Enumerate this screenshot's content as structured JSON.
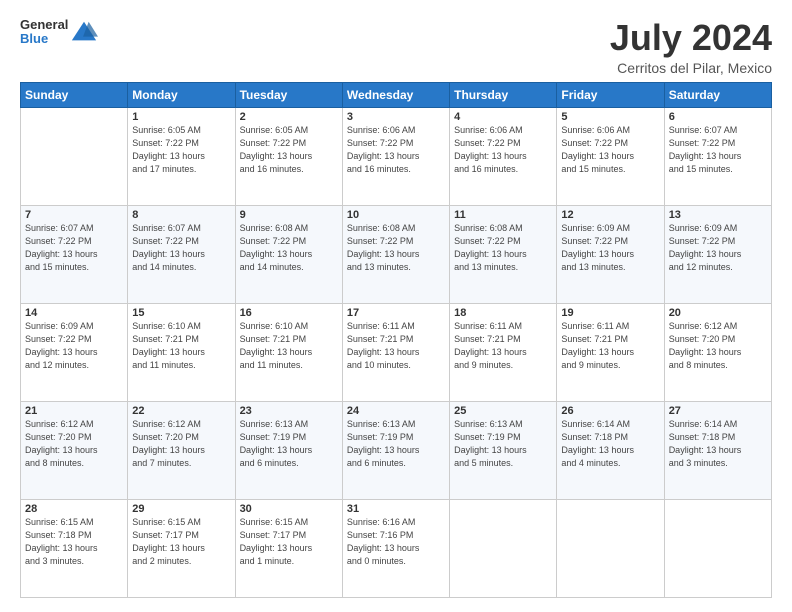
{
  "logo": {
    "line1": "General",
    "line2": "Blue"
  },
  "title": "July 2024",
  "subtitle": "Cerritos del Pilar, Mexico",
  "days_header": [
    "Sunday",
    "Monday",
    "Tuesday",
    "Wednesday",
    "Thursday",
    "Friday",
    "Saturday"
  ],
  "weeks": [
    [
      {
        "num": "",
        "info": ""
      },
      {
        "num": "1",
        "info": "Sunrise: 6:05 AM\nSunset: 7:22 PM\nDaylight: 13 hours\nand 17 minutes."
      },
      {
        "num": "2",
        "info": "Sunrise: 6:05 AM\nSunset: 7:22 PM\nDaylight: 13 hours\nand 16 minutes."
      },
      {
        "num": "3",
        "info": "Sunrise: 6:06 AM\nSunset: 7:22 PM\nDaylight: 13 hours\nand 16 minutes."
      },
      {
        "num": "4",
        "info": "Sunrise: 6:06 AM\nSunset: 7:22 PM\nDaylight: 13 hours\nand 16 minutes."
      },
      {
        "num": "5",
        "info": "Sunrise: 6:06 AM\nSunset: 7:22 PM\nDaylight: 13 hours\nand 15 minutes."
      },
      {
        "num": "6",
        "info": "Sunrise: 6:07 AM\nSunset: 7:22 PM\nDaylight: 13 hours\nand 15 minutes."
      }
    ],
    [
      {
        "num": "7",
        "info": "Sunrise: 6:07 AM\nSunset: 7:22 PM\nDaylight: 13 hours\nand 15 minutes."
      },
      {
        "num": "8",
        "info": "Sunrise: 6:07 AM\nSunset: 7:22 PM\nDaylight: 13 hours\nand 14 minutes."
      },
      {
        "num": "9",
        "info": "Sunrise: 6:08 AM\nSunset: 7:22 PM\nDaylight: 13 hours\nand 14 minutes."
      },
      {
        "num": "10",
        "info": "Sunrise: 6:08 AM\nSunset: 7:22 PM\nDaylight: 13 hours\nand 13 minutes."
      },
      {
        "num": "11",
        "info": "Sunrise: 6:08 AM\nSunset: 7:22 PM\nDaylight: 13 hours\nand 13 minutes."
      },
      {
        "num": "12",
        "info": "Sunrise: 6:09 AM\nSunset: 7:22 PM\nDaylight: 13 hours\nand 13 minutes."
      },
      {
        "num": "13",
        "info": "Sunrise: 6:09 AM\nSunset: 7:22 PM\nDaylight: 13 hours\nand 12 minutes."
      }
    ],
    [
      {
        "num": "14",
        "info": "Sunrise: 6:09 AM\nSunset: 7:22 PM\nDaylight: 13 hours\nand 12 minutes."
      },
      {
        "num": "15",
        "info": "Sunrise: 6:10 AM\nSunset: 7:21 PM\nDaylight: 13 hours\nand 11 minutes."
      },
      {
        "num": "16",
        "info": "Sunrise: 6:10 AM\nSunset: 7:21 PM\nDaylight: 13 hours\nand 11 minutes."
      },
      {
        "num": "17",
        "info": "Sunrise: 6:11 AM\nSunset: 7:21 PM\nDaylight: 13 hours\nand 10 minutes."
      },
      {
        "num": "18",
        "info": "Sunrise: 6:11 AM\nSunset: 7:21 PM\nDaylight: 13 hours\nand 9 minutes."
      },
      {
        "num": "19",
        "info": "Sunrise: 6:11 AM\nSunset: 7:21 PM\nDaylight: 13 hours\nand 9 minutes."
      },
      {
        "num": "20",
        "info": "Sunrise: 6:12 AM\nSunset: 7:20 PM\nDaylight: 13 hours\nand 8 minutes."
      }
    ],
    [
      {
        "num": "21",
        "info": "Sunrise: 6:12 AM\nSunset: 7:20 PM\nDaylight: 13 hours\nand 8 minutes."
      },
      {
        "num": "22",
        "info": "Sunrise: 6:12 AM\nSunset: 7:20 PM\nDaylight: 13 hours\nand 7 minutes."
      },
      {
        "num": "23",
        "info": "Sunrise: 6:13 AM\nSunset: 7:19 PM\nDaylight: 13 hours\nand 6 minutes."
      },
      {
        "num": "24",
        "info": "Sunrise: 6:13 AM\nSunset: 7:19 PM\nDaylight: 13 hours\nand 6 minutes."
      },
      {
        "num": "25",
        "info": "Sunrise: 6:13 AM\nSunset: 7:19 PM\nDaylight: 13 hours\nand 5 minutes."
      },
      {
        "num": "26",
        "info": "Sunrise: 6:14 AM\nSunset: 7:18 PM\nDaylight: 13 hours\nand 4 minutes."
      },
      {
        "num": "27",
        "info": "Sunrise: 6:14 AM\nSunset: 7:18 PM\nDaylight: 13 hours\nand 3 minutes."
      }
    ],
    [
      {
        "num": "28",
        "info": "Sunrise: 6:15 AM\nSunset: 7:18 PM\nDaylight: 13 hours\nand 3 minutes."
      },
      {
        "num": "29",
        "info": "Sunrise: 6:15 AM\nSunset: 7:17 PM\nDaylight: 13 hours\nand 2 minutes."
      },
      {
        "num": "30",
        "info": "Sunrise: 6:15 AM\nSunset: 7:17 PM\nDaylight: 13 hours\nand 1 minute."
      },
      {
        "num": "31",
        "info": "Sunrise: 6:16 AM\nSunset: 7:16 PM\nDaylight: 13 hours\nand 0 minutes."
      },
      {
        "num": "",
        "info": ""
      },
      {
        "num": "",
        "info": ""
      },
      {
        "num": "",
        "info": ""
      }
    ]
  ]
}
